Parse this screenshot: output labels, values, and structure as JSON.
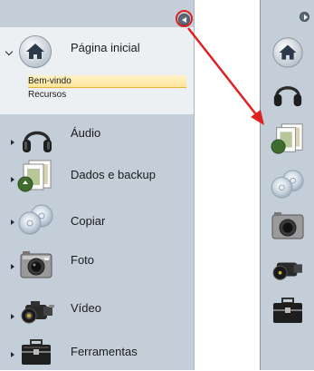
{
  "colors": {
    "sidebar_bg": "#c3ced9",
    "home_section_bg": "#edf0f3",
    "selection_bg": "#fde39a",
    "highlight_red": "#e02020"
  },
  "sidebar": {
    "home": {
      "label": "Página inicial",
      "icon": "home-icon",
      "expanded": true,
      "subitems": [
        {
          "label": "Bem-vindo",
          "selected": true
        },
        {
          "label": "Recursos",
          "selected": false
        }
      ]
    },
    "items": [
      {
        "label": "Áudio",
        "icon": "headphones-icon"
      },
      {
        "label": "Dados e backup",
        "icon": "data-backup-icon"
      },
      {
        "label": "Copiar",
        "icon": "copy-disc-icon"
      },
      {
        "label": "Foto",
        "icon": "camera-icon"
      },
      {
        "label": "Vídeo",
        "icon": "video-camera-icon"
      },
      {
        "label": "Ferramentas",
        "icon": "toolbox-icon"
      }
    ]
  },
  "collapsed_sidebar": {
    "icons": [
      "home-icon",
      "headphones-icon",
      "data-backup-icon",
      "copy-disc-icon",
      "camera-icon",
      "video-camera-icon",
      "toolbox-icon"
    ]
  }
}
